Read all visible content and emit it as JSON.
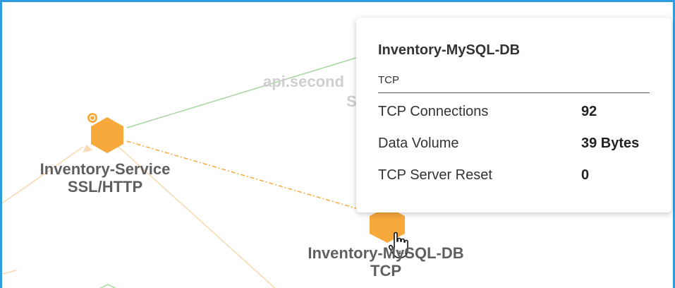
{
  "nodes": {
    "inventory_service": {
      "name": "Inventory-Service",
      "protocol": "SSL/HTTP"
    },
    "mysql_db": {
      "name": "Inventory-MySQL-DB",
      "protocol": "TCP"
    },
    "background_node": {
      "name_partial": "api.second",
      "protocol_partial": "S"
    }
  },
  "tooltip": {
    "title": "Inventory-MySQL-DB",
    "protocol": "TCP",
    "metrics": [
      {
        "label": "TCP Connections",
        "value": "92"
      },
      {
        "label": "Data Volume",
        "value": "39 Bytes"
      },
      {
        "label": "TCP Server Reset",
        "value": "0"
      }
    ]
  },
  "colors": {
    "accent_border": "#2f9ee0",
    "node_fill": "#f7a93c",
    "link_green": "#a8d5a2",
    "link_orange": "#f7a93c",
    "link_faint": "#f8d9b0"
  },
  "icons": {
    "cursor": "hand-pointer-icon",
    "node": "hexagon-icon",
    "badge": "alert-badge-icon"
  }
}
